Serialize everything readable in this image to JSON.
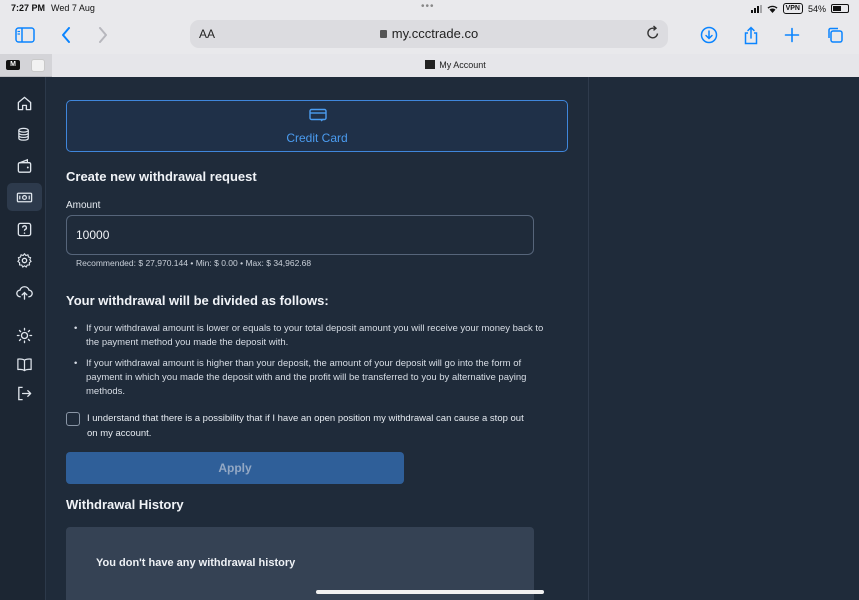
{
  "status_bar": {
    "time": "7:27 PM",
    "date": "Wed 7 Aug",
    "vpn": "VPN",
    "battery": "54%"
  },
  "browser": {
    "text_size_label": "AA",
    "url": "my.ccctrade.co",
    "tab_title": "My Account",
    "tab1_favicon": "M"
  },
  "sidebar": {
    "items": [
      {
        "icon": "home-icon"
      },
      {
        "icon": "coins-icon"
      },
      {
        "icon": "wallet-icon"
      },
      {
        "icon": "withdraw-money-icon",
        "active": true
      },
      {
        "icon": "help-icon"
      },
      {
        "icon": "settings-icon"
      },
      {
        "icon": "upload-icon"
      },
      {
        "icon": "sun-icon"
      },
      {
        "icon": "book-icon"
      },
      {
        "icon": "logout-icon"
      }
    ]
  },
  "payment_method": {
    "label": "Credit Card",
    "icon": "credit-card-icon"
  },
  "form": {
    "heading": "Create new withdrawal request",
    "amount_label": "Amount",
    "amount_value": "10000",
    "hint": "Recommended: $ 27,970.144 • Min: $ 0.00 • Max: $ 34,962.68"
  },
  "division": {
    "heading": "Your withdrawal will be divided as follows:",
    "bullets": [
      "If your withdrawal amount is lower or equals to your total deposit amount you will receive your money back to the payment method you made the deposit with.",
      "If your withdrawal amount is higher than your deposit, the amount of your deposit will go into the form of payment in which you made the deposit with and the profit will be transferred to you by alternative paying methods."
    ]
  },
  "consent": {
    "text": "I understand that there is a possibility that if I have an open position my withdrawal can cause a stop out on my account.",
    "checked": false
  },
  "apply_label": "Apply",
  "history": {
    "heading": "Withdrawal History",
    "empty_text": "You don't have any withdrawal history"
  },
  "colors": {
    "accent": "#3f86db",
    "background": "#1f2b3a",
    "button": "#2f5f99"
  }
}
